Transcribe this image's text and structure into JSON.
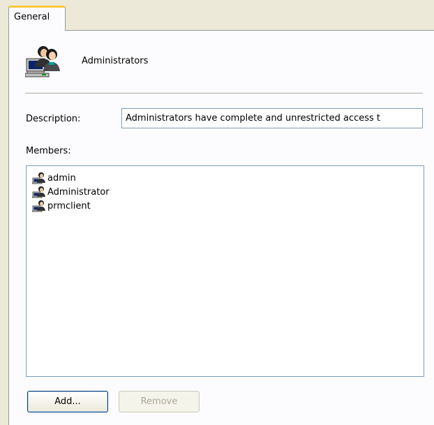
{
  "tab": {
    "label": "General"
  },
  "group": {
    "name": "Administrators",
    "icon": "user-group-computer-icon"
  },
  "description": {
    "label": "Description:",
    "value": "Administrators have complete and unrestricted access t"
  },
  "members": {
    "label": "Members:",
    "items": [
      {
        "name": "admin",
        "icon": "user-icon"
      },
      {
        "name": "Administrator",
        "icon": "user-icon"
      },
      {
        "name": "prmclient",
        "icon": "user-icon"
      }
    ]
  },
  "buttons": {
    "add_label": "Add...",
    "remove_label": "Remove"
  },
  "colors": {
    "window_bg": "#ece9d8",
    "panel_bg": "#fcfcfe",
    "tab_highlight": "#ffc83c",
    "input_border": "#7f9db9",
    "disabled_text": "#aca899"
  }
}
